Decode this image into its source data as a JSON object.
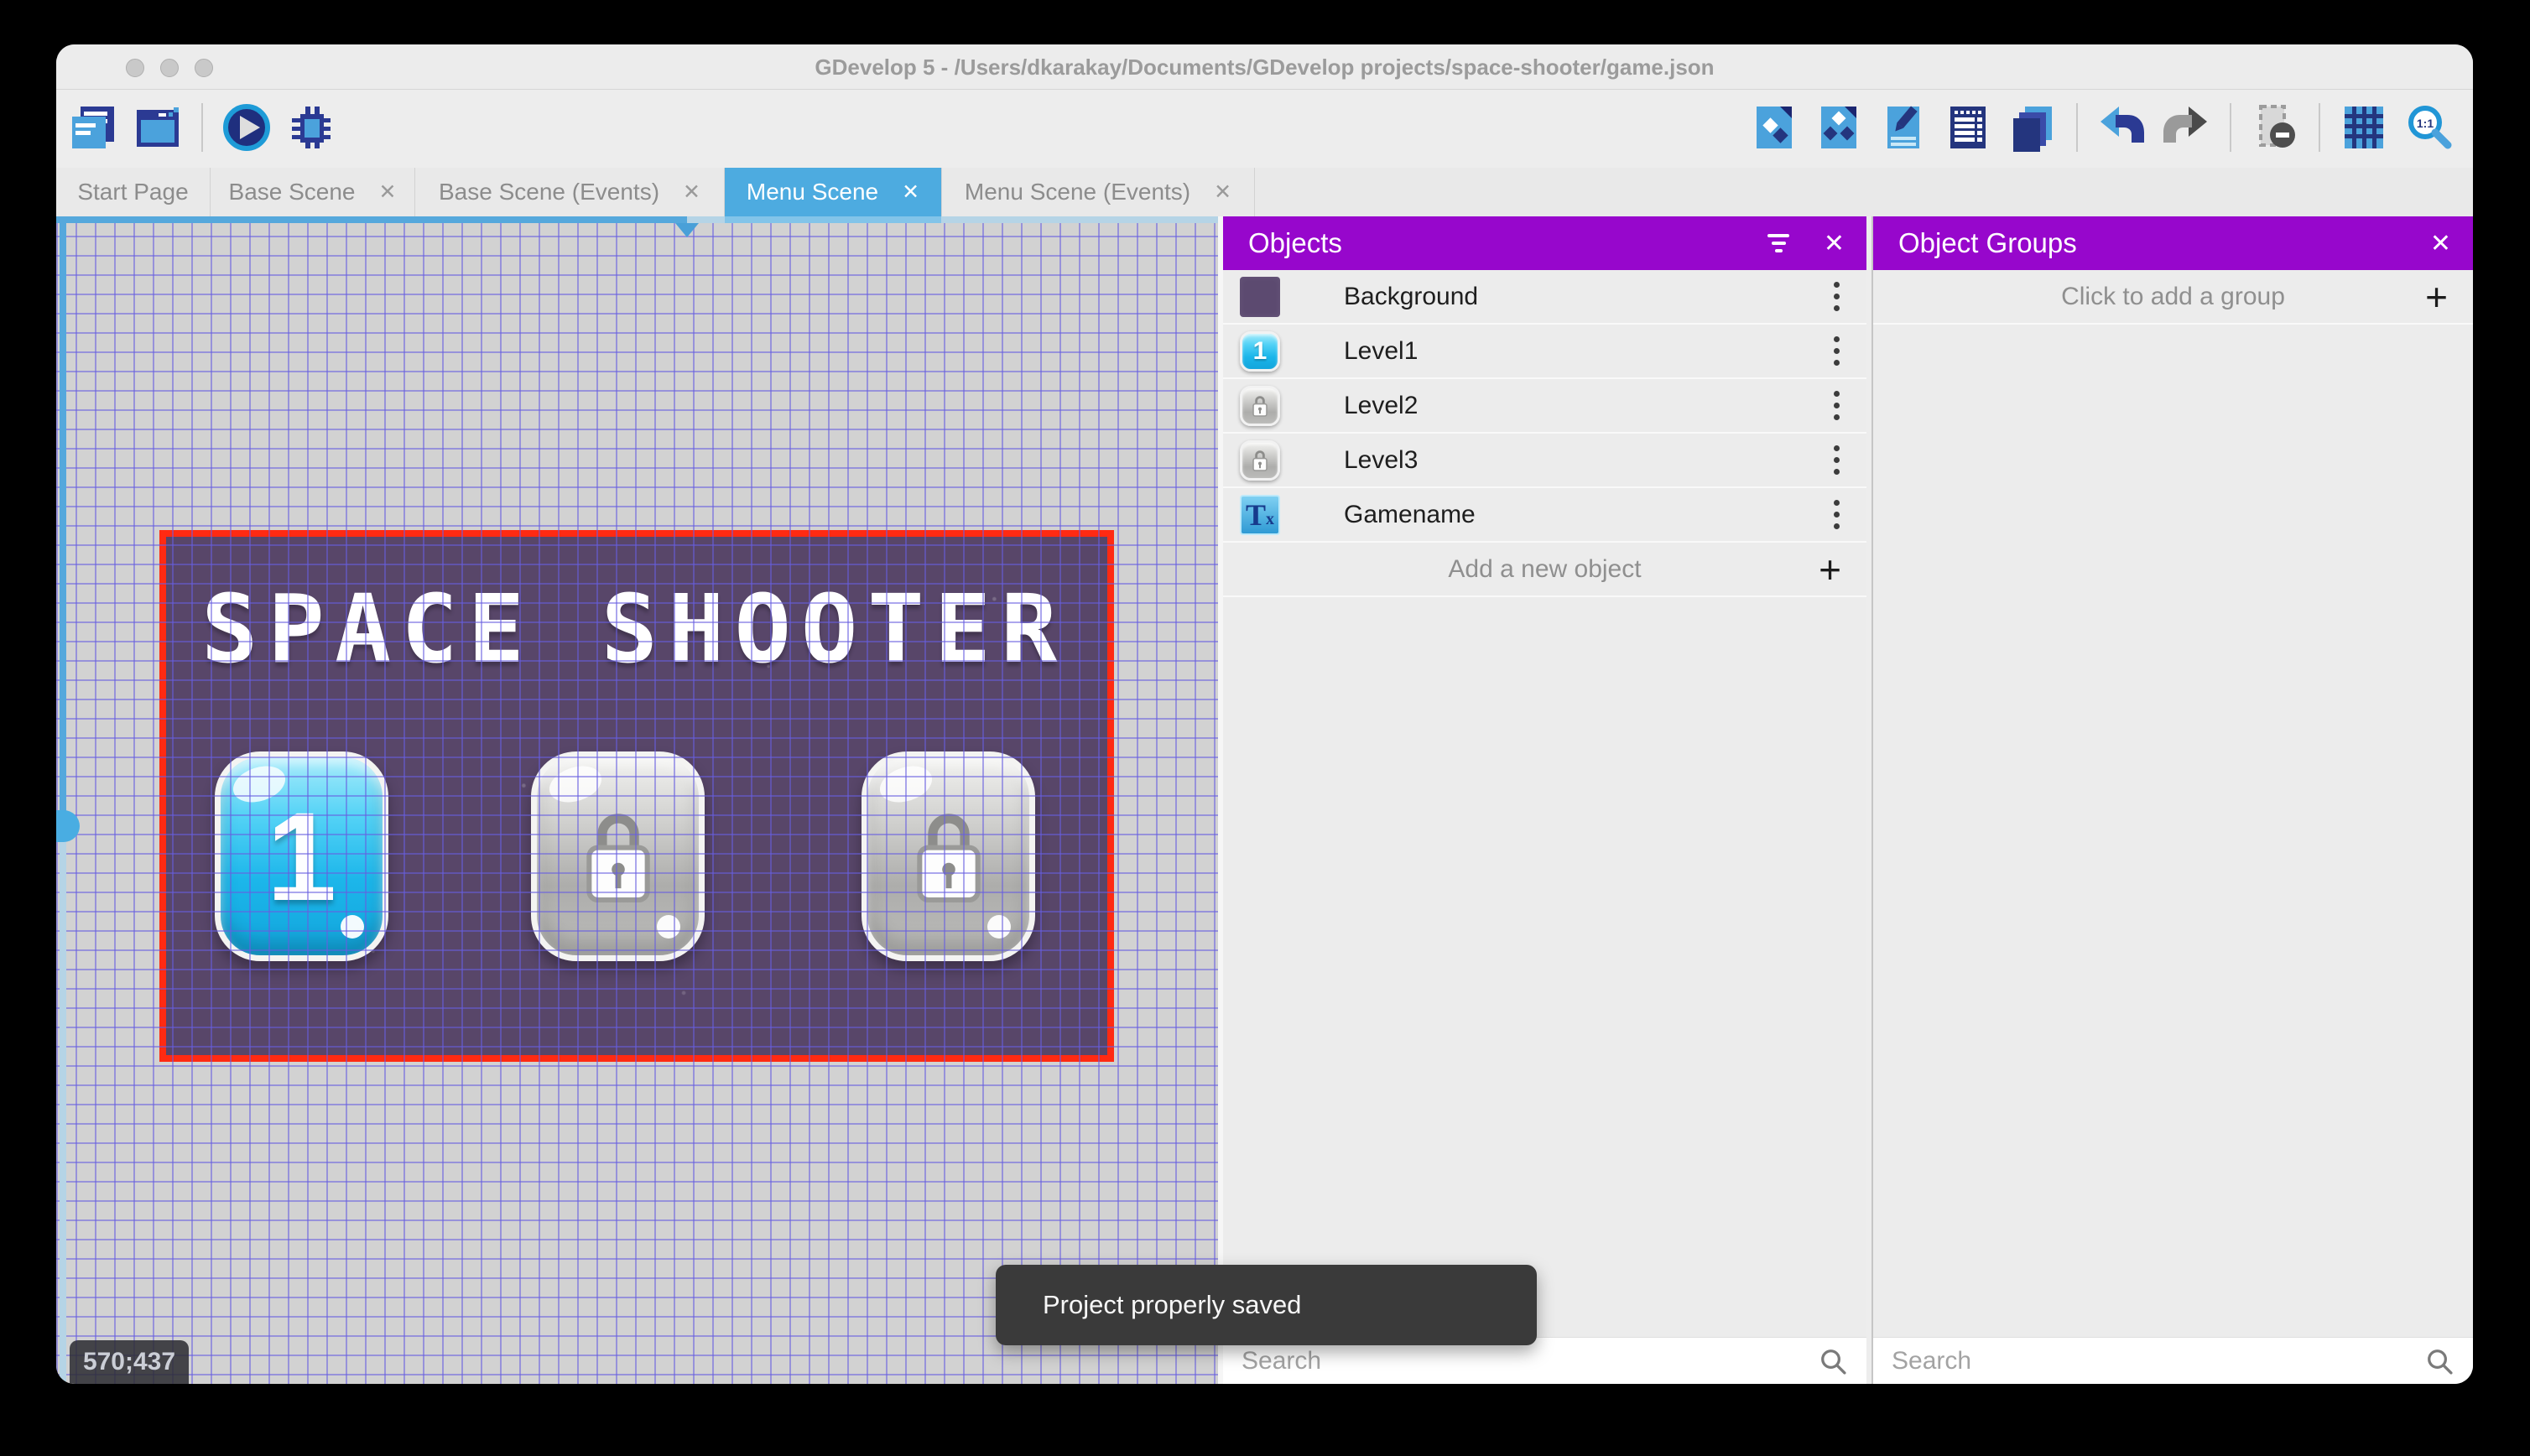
{
  "window": {
    "title": "GDevelop 5 - /Users/dkarakay/Documents/GDevelop projects/space-shooter/game.json"
  },
  "icons": {
    "close": "✕",
    "plus": "+",
    "text_T": "T",
    "text_x": "x"
  },
  "toolbar": {
    "left_icons": [
      "project-manager",
      "scene-window",
      "play-preview",
      "debug"
    ],
    "right_icons": [
      "objects-editor",
      "object-groups-editor",
      "properties",
      "instances-list",
      "layers",
      "undo",
      "redo",
      "instances-mask",
      "grid",
      "zoom-1-1"
    ]
  },
  "tabs": {
    "close_glyph": "✕",
    "items": [
      {
        "label": "Start Page",
        "closable": false,
        "active": false
      },
      {
        "label": "Base Scene",
        "closable": true,
        "active": false
      },
      {
        "label": "Base Scene (Events)",
        "closable": true,
        "active": false
      },
      {
        "label": "Menu Scene",
        "closable": true,
        "active": true
      },
      {
        "label": "Menu Scene (Events)",
        "closable": true,
        "active": false
      }
    ]
  },
  "canvas": {
    "coordinates": "570;437",
    "scene": {
      "title": "SPACE SHOOTER",
      "buttons": [
        {
          "label": "1",
          "state": "unlocked"
        },
        {
          "label": "",
          "state": "locked"
        },
        {
          "label": "",
          "state": "locked"
        }
      ]
    }
  },
  "objects_panel": {
    "title": "Objects",
    "items": [
      {
        "name": "Background",
        "icon": "background-swatch"
      },
      {
        "name": "Level1",
        "icon": "level1-button"
      },
      {
        "name": "Level2",
        "icon": "locked-button"
      },
      {
        "name": "Level3",
        "icon": "locked-button"
      },
      {
        "name": "Gamename",
        "icon": "text-object"
      }
    ],
    "add_label": "Add a new object",
    "search_placeholder": "Search"
  },
  "object_groups_panel": {
    "title": "Object Groups",
    "add_label": "Click to add a group",
    "search_placeholder": "Search"
  },
  "toast": {
    "message": "Project properly saved"
  },
  "colors": {
    "panel_purple": "#9707CC",
    "active_tab_blue": "#4DABE0",
    "selection_red": "#FF2A12",
    "scene_purple": "#584669",
    "icon_navy": "#2B3A93",
    "icon_blue": "#4BA2DC"
  }
}
